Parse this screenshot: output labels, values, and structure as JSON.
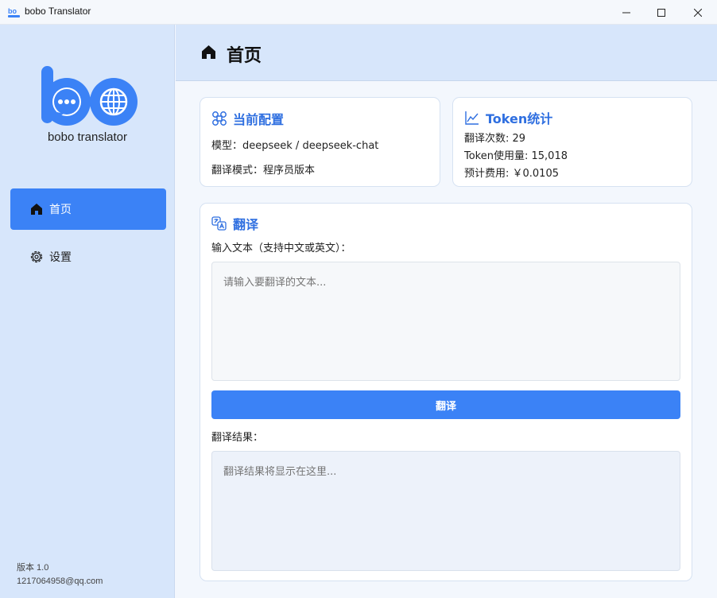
{
  "window": {
    "title": "bobo Translator"
  },
  "sidebar": {
    "logo_text": "bobo translator",
    "items": [
      {
        "label": "首页",
        "icon": "home-icon",
        "active": true
      },
      {
        "label": "设置",
        "icon": "gear-icon",
        "active": false
      }
    ],
    "version": "版本 1.0",
    "email": "1217064958@qq.com"
  },
  "header": {
    "title": "首页",
    "icon": "home-icon"
  },
  "config_card": {
    "title": "当前配置",
    "model": "模型：deepseek / deepseek-chat",
    "mode": "翻译模式：程序员版本"
  },
  "token_card": {
    "title": "Token统计",
    "count": "翻译次数: 29",
    "usage": "Token使用量: 15,018",
    "cost": "预计费用: ￥0.0105"
  },
  "translate_card": {
    "title": "翻译",
    "input_label": "输入文本（支持中文或英文）：",
    "input_placeholder": "请输入要翻译的文本...",
    "button_label": "翻译",
    "result_label": "翻译结果：",
    "result_placeholder": "翻译结果将显示在这里..."
  },
  "colors": {
    "accent": "#3b82f6",
    "heading_blue": "#2f6fe0",
    "sidebar_bg": "#d7e6fb",
    "content_bg": "#f3f7fd"
  }
}
